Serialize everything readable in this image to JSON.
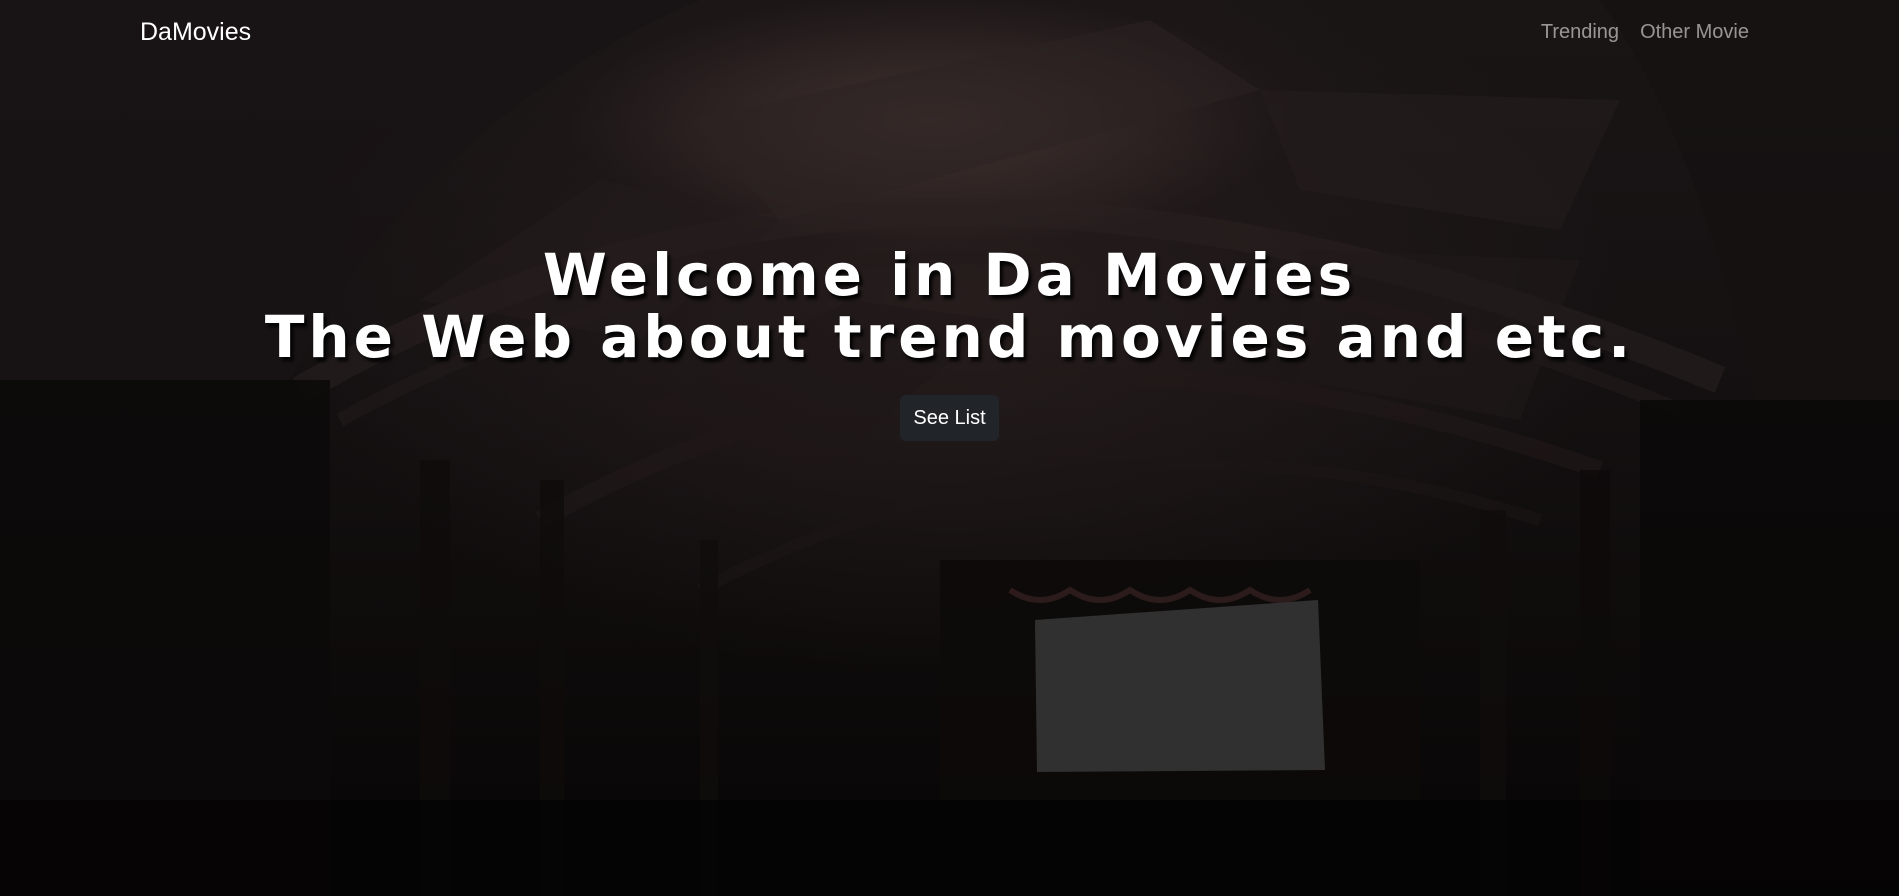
{
  "nav": {
    "brand": "DaMovies",
    "links": [
      "Trending",
      "Other Movie"
    ]
  },
  "hero": {
    "title_line1": "Welcome in Da Movies",
    "title_line2": "The Web about trend movies and etc.",
    "cta_label": "See List",
    "background_image": "dark-cinema-theater"
  },
  "colors": {
    "brand_text": "#ffffff",
    "nav_link": "#8c8c8c",
    "button_bg": "#212529",
    "overlay": "#0b0909"
  }
}
